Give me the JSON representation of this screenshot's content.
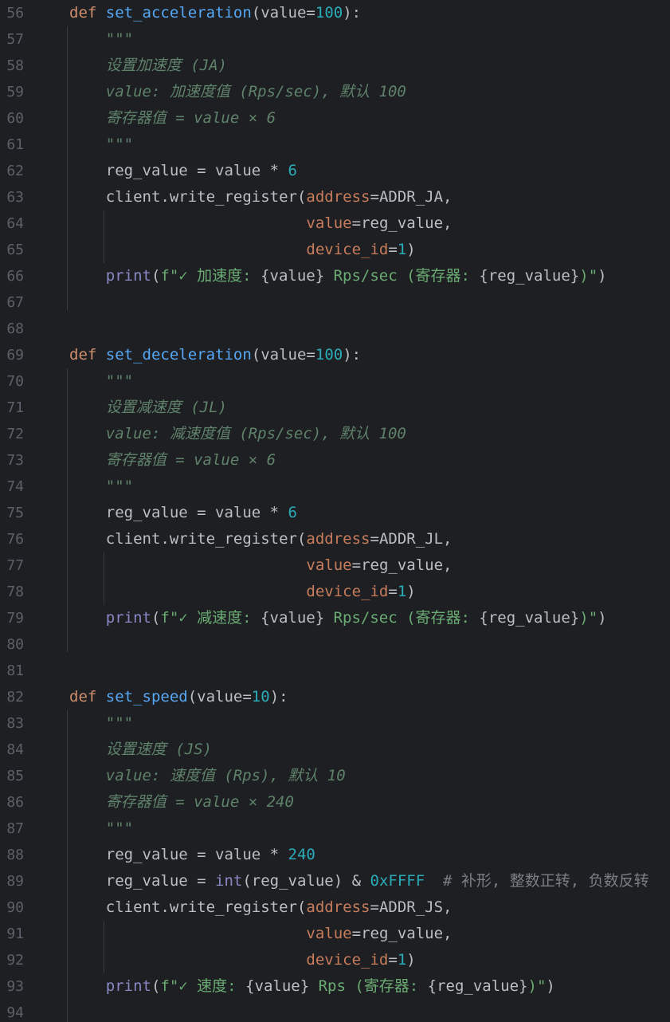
{
  "editor": {
    "language": "python",
    "lines": [
      {
        "num": "56",
        "tokens": [
          {
            "t": "kw",
            "v": "def "
          },
          {
            "t": "fn",
            "v": "set_acceleration"
          },
          {
            "t": "p",
            "v": "(value="
          },
          {
            "t": "num",
            "v": "100"
          },
          {
            "t": "p",
            "v": "):"
          }
        ]
      },
      {
        "num": "57",
        "tokens": [
          {
            "t": "p",
            "v": "    "
          },
          {
            "t": "doc",
            "v": "\"\"\""
          }
        ]
      },
      {
        "num": "58",
        "tokens": [
          {
            "t": "p",
            "v": "    "
          },
          {
            "t": "doc",
            "v": "设置加速度 (JA)"
          }
        ]
      },
      {
        "num": "59",
        "tokens": [
          {
            "t": "p",
            "v": "    "
          },
          {
            "t": "doc",
            "v": "value: 加速度值 (Rps/sec), 默认 100"
          }
        ]
      },
      {
        "num": "60",
        "tokens": [
          {
            "t": "p",
            "v": "    "
          },
          {
            "t": "doc",
            "v": "寄存器值 = value × 6"
          }
        ]
      },
      {
        "num": "61",
        "tokens": [
          {
            "t": "p",
            "v": "    "
          },
          {
            "t": "doc",
            "v": "\"\"\""
          }
        ]
      },
      {
        "num": "62",
        "tokens": [
          {
            "t": "p",
            "v": "    reg_value = value * "
          },
          {
            "t": "num",
            "v": "6"
          }
        ]
      },
      {
        "num": "63",
        "tokens": [
          {
            "t": "p",
            "v": "    client.write_register("
          },
          {
            "t": "param",
            "v": "address"
          },
          {
            "t": "p",
            "v": "=ADDR_JA,"
          }
        ]
      },
      {
        "num": "64",
        "tokens": [
          {
            "t": "p",
            "v": "                          "
          },
          {
            "t": "param",
            "v": "value"
          },
          {
            "t": "p",
            "v": "=reg_value,"
          }
        ]
      },
      {
        "num": "65",
        "tokens": [
          {
            "t": "p",
            "v": "                          "
          },
          {
            "t": "param",
            "v": "device_id"
          },
          {
            "t": "p",
            "v": "="
          },
          {
            "t": "num",
            "v": "1"
          },
          {
            "t": "p",
            "v": ")"
          }
        ]
      },
      {
        "num": "66",
        "tokens": [
          {
            "t": "p",
            "v": "    "
          },
          {
            "t": "bi",
            "v": "print"
          },
          {
            "t": "p",
            "v": "("
          },
          {
            "t": "str",
            "v": "f\"✓ 加速度: "
          },
          {
            "t": "p",
            "v": "{value}"
          },
          {
            "t": "str",
            "v": " Rps/sec (寄存器: "
          },
          {
            "t": "p",
            "v": "{reg_value}"
          },
          {
            "t": "str",
            "v": ")\""
          },
          {
            "t": "p",
            "v": ")"
          }
        ]
      },
      {
        "num": "67",
        "tokens": []
      },
      {
        "num": "68",
        "tokens": []
      },
      {
        "num": "69",
        "tokens": [
          {
            "t": "kw",
            "v": "def "
          },
          {
            "t": "fn",
            "v": "set_deceleration"
          },
          {
            "t": "p",
            "v": "(value="
          },
          {
            "t": "num",
            "v": "100"
          },
          {
            "t": "p",
            "v": "):"
          }
        ]
      },
      {
        "num": "70",
        "tokens": [
          {
            "t": "p",
            "v": "    "
          },
          {
            "t": "doc",
            "v": "\"\"\""
          }
        ]
      },
      {
        "num": "71",
        "tokens": [
          {
            "t": "p",
            "v": "    "
          },
          {
            "t": "doc",
            "v": "设置减速度 (JL)"
          }
        ]
      },
      {
        "num": "72",
        "tokens": [
          {
            "t": "p",
            "v": "    "
          },
          {
            "t": "doc",
            "v": "value: 减速度值 (Rps/sec), 默认 100"
          }
        ]
      },
      {
        "num": "73",
        "tokens": [
          {
            "t": "p",
            "v": "    "
          },
          {
            "t": "doc",
            "v": "寄存器值 = value × 6"
          }
        ]
      },
      {
        "num": "74",
        "tokens": [
          {
            "t": "p",
            "v": "    "
          },
          {
            "t": "doc",
            "v": "\"\"\""
          }
        ]
      },
      {
        "num": "75",
        "tokens": [
          {
            "t": "p",
            "v": "    reg_value = value * "
          },
          {
            "t": "num",
            "v": "6"
          }
        ]
      },
      {
        "num": "76",
        "tokens": [
          {
            "t": "p",
            "v": "    client.write_register("
          },
          {
            "t": "param",
            "v": "address"
          },
          {
            "t": "p",
            "v": "=ADDR_JL,"
          }
        ]
      },
      {
        "num": "77",
        "tokens": [
          {
            "t": "p",
            "v": "                          "
          },
          {
            "t": "param",
            "v": "value"
          },
          {
            "t": "p",
            "v": "=reg_value,"
          }
        ]
      },
      {
        "num": "78",
        "tokens": [
          {
            "t": "p",
            "v": "                          "
          },
          {
            "t": "param",
            "v": "device_id"
          },
          {
            "t": "p",
            "v": "="
          },
          {
            "t": "num",
            "v": "1"
          },
          {
            "t": "p",
            "v": ")"
          }
        ]
      },
      {
        "num": "79",
        "tokens": [
          {
            "t": "p",
            "v": "    "
          },
          {
            "t": "bi",
            "v": "print"
          },
          {
            "t": "p",
            "v": "("
          },
          {
            "t": "str",
            "v": "f\"✓ 减速度: "
          },
          {
            "t": "p",
            "v": "{value}"
          },
          {
            "t": "str",
            "v": " Rps/sec (寄存器: "
          },
          {
            "t": "p",
            "v": "{reg_value}"
          },
          {
            "t": "str",
            "v": ")\""
          },
          {
            "t": "p",
            "v": ")"
          }
        ]
      },
      {
        "num": "80",
        "tokens": []
      },
      {
        "num": "81",
        "tokens": []
      },
      {
        "num": "82",
        "tokens": [
          {
            "t": "kw",
            "v": "def "
          },
          {
            "t": "fn",
            "v": "set_speed"
          },
          {
            "t": "p",
            "v": "(value="
          },
          {
            "t": "num",
            "v": "10"
          },
          {
            "t": "p",
            "v": "):"
          }
        ]
      },
      {
        "num": "83",
        "tokens": [
          {
            "t": "p",
            "v": "    "
          },
          {
            "t": "doc",
            "v": "\"\"\""
          }
        ]
      },
      {
        "num": "84",
        "tokens": [
          {
            "t": "p",
            "v": "    "
          },
          {
            "t": "doc",
            "v": "设置速度 (JS)"
          }
        ]
      },
      {
        "num": "85",
        "tokens": [
          {
            "t": "p",
            "v": "    "
          },
          {
            "t": "doc",
            "v": "value: 速度值 (Rps), 默认 10"
          }
        ]
      },
      {
        "num": "86",
        "tokens": [
          {
            "t": "p",
            "v": "    "
          },
          {
            "t": "doc",
            "v": "寄存器值 = value × 240"
          }
        ]
      },
      {
        "num": "87",
        "tokens": [
          {
            "t": "p",
            "v": "    "
          },
          {
            "t": "doc",
            "v": "\"\"\""
          }
        ]
      },
      {
        "num": "88",
        "tokens": [
          {
            "t": "p",
            "v": "    reg_value = value * "
          },
          {
            "t": "num",
            "v": "240"
          }
        ]
      },
      {
        "num": "89",
        "tokens": [
          {
            "t": "p",
            "v": "    reg_value = "
          },
          {
            "t": "bi",
            "v": "int"
          },
          {
            "t": "p",
            "v": "(reg_value) & "
          },
          {
            "t": "num",
            "v": "0xFFFF"
          },
          {
            "t": "cmt",
            "v": "  # 补形, 整数正转, 负数反转"
          }
        ]
      },
      {
        "num": "90",
        "tokens": [
          {
            "t": "p",
            "v": "    client.write_register("
          },
          {
            "t": "param",
            "v": "address"
          },
          {
            "t": "p",
            "v": "=ADDR_JS,"
          }
        ]
      },
      {
        "num": "91",
        "tokens": [
          {
            "t": "p",
            "v": "                          "
          },
          {
            "t": "param",
            "v": "value"
          },
          {
            "t": "p",
            "v": "=reg_value,"
          }
        ]
      },
      {
        "num": "92",
        "tokens": [
          {
            "t": "p",
            "v": "                          "
          },
          {
            "t": "param",
            "v": "device_id"
          },
          {
            "t": "p",
            "v": "="
          },
          {
            "t": "num",
            "v": "1"
          },
          {
            "t": "p",
            "v": ")"
          }
        ]
      },
      {
        "num": "93",
        "tokens": [
          {
            "t": "p",
            "v": "    "
          },
          {
            "t": "bi",
            "v": "print"
          },
          {
            "t": "p",
            "v": "("
          },
          {
            "t": "str",
            "v": "f\"✓ 速度: "
          },
          {
            "t": "p",
            "v": "{value}"
          },
          {
            "t": "str",
            "v": " Rps (寄存器: "
          },
          {
            "t": "p",
            "v": "{reg_value}"
          },
          {
            "t": "str",
            "v": ")\""
          },
          {
            "t": "p",
            "v": ")"
          }
        ]
      },
      {
        "num": "94",
        "tokens": []
      }
    ]
  }
}
